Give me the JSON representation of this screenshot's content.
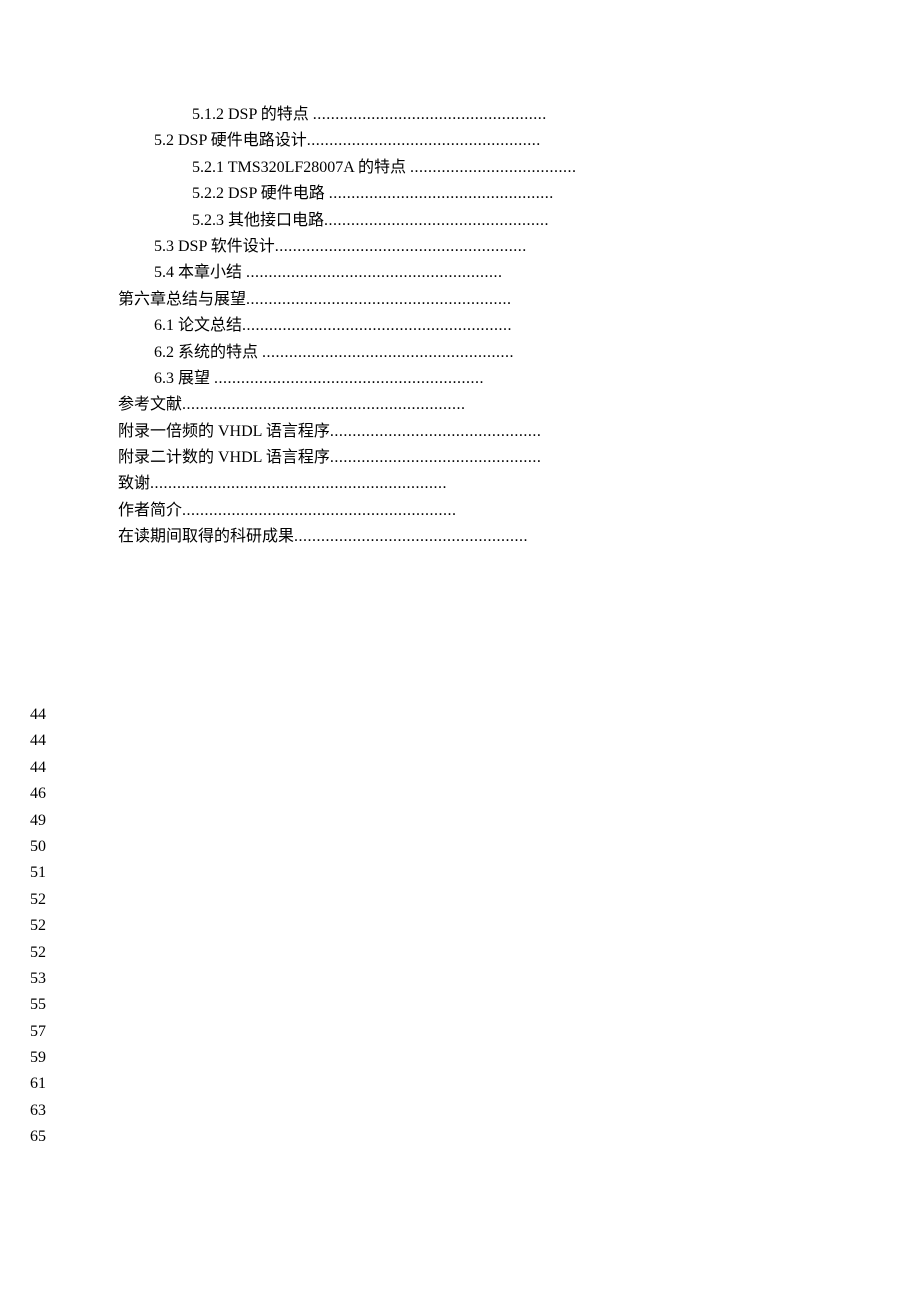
{
  "toc": [
    {
      "indent": 2,
      "label": "5.1.2 DSP 的特点 ",
      "dots": "...................................................."
    },
    {
      "indent": 1,
      "label": "5.2 DSP 硬件电路设计",
      "dots": "...................................................."
    },
    {
      "indent": 2,
      "label": "5.2.1 TMS320LF28007A 的特点 ",
      "dots": "....................................."
    },
    {
      "indent": 2,
      "label": "5.2.2 DSP 硬件电路 ",
      "dots": ".................................................."
    },
    {
      "indent": 2,
      "label": "5.2.3 其他接口电路",
      "dots": ".................................................."
    },
    {
      "indent": 1,
      "label": "5.3 DSP 软件设计",
      "dots": "........................................................"
    },
    {
      "indent": 1,
      "label": "5.4 本章小结 ",
      "dots": "........................................................."
    },
    {
      "indent": 0,
      "label": "第六章总结与展望",
      "dots": "..........................................................."
    },
    {
      "indent": 1,
      "label": "6.1 论文总结",
      "dots": "............................................................"
    },
    {
      "indent": 1,
      "label": "6.2 系统的特点 ",
      "dots": "........................................................"
    },
    {
      "indent": 1,
      "label": "6.3 展望 ",
      "dots": "............................................................"
    },
    {
      "indent": 0,
      "label": "参考文献",
      "dots": "..............................................................."
    },
    {
      "indent": 0,
      "label": "附录一倍频的 VHDL 语言程序",
      "dots": "..............................................."
    },
    {
      "indent": 0,
      "label": "附录二计数的 VHDL 语言程序",
      "dots": "..............................................."
    },
    {
      "indent": 0,
      "label": "致谢",
      "dots": ".................................................................."
    },
    {
      "indent": 0,
      "label": "作者简介",
      "dots": "............................................................."
    },
    {
      "indent": 0,
      "label": "在读期间取得的科研成果",
      "dots": "...................................................."
    }
  ],
  "pages": [
    "44",
    "44",
    "44",
    "46",
    "49",
    "50",
    "51",
    "52",
    "52",
    "52",
    "53",
    "55",
    "57",
    "59",
    "61",
    "63",
    "65"
  ]
}
